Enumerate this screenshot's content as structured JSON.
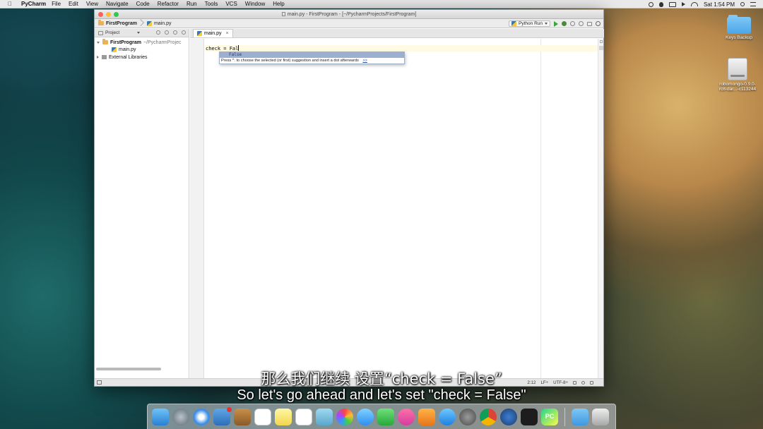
{
  "menubar": {
    "app_name": "PyCharm",
    "items": [
      "File",
      "Edit",
      "View",
      "Navigate",
      "Code",
      "Refactor",
      "Run",
      "Tools",
      "VCS",
      "Window",
      "Help"
    ],
    "clock": "Sat 1:54 PM"
  },
  "window": {
    "title": "main.py - FirstProgram - [~/PycharmProjects/FirstProgram]"
  },
  "navbar": {
    "crumbs": [
      "FirstProgram",
      "main.py"
    ],
    "run_config": "Python Run"
  },
  "project_panel": {
    "header": "Project",
    "tree": {
      "root_name": "FirstProgram",
      "root_path": "~/PycharmProjec",
      "file": "main.py",
      "libraries": "External Libraries"
    }
  },
  "editor": {
    "tab_label": "main.py",
    "code_line": "check = Fal",
    "completion": {
      "suggestion": "False",
      "hint": "Press ^. to choose the selected (or first) suggestion and insert a dot afterwards",
      "hint_link": ">>"
    }
  },
  "statusbar": {
    "position": "2:12",
    "line_sep": "LF÷",
    "encoding": "UTF-8÷"
  },
  "desktop": {
    "folder_label": "Keys Backup",
    "disk_label_1": "robomongo-0.9.0-",
    "disk_label_2": "rc8-dar...-c113244"
  },
  "subtitles": {
    "chinese": "那么我们继续  设置“check = False”",
    "english": "So let's go ahead and let's set \"check = False\""
  },
  "dock": {
    "pycharm_label": "PC"
  }
}
